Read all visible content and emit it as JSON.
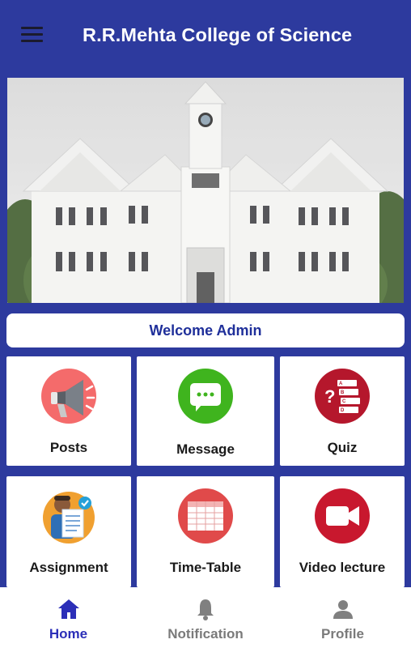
{
  "app_bar": {
    "title": "R.R.Mehta College of Science",
    "menu_icon": "hamburger-menu-icon"
  },
  "banner": {
    "image": "college-building-photo"
  },
  "welcome": {
    "text": "Welcome Admin"
  },
  "tiles": [
    {
      "label": "Posts",
      "icon": "megaphone-icon",
      "color": "#f46b6b"
    },
    {
      "label": "Message",
      "icon": "chat-bubble-icon",
      "color": "#3fb41e"
    },
    {
      "label": "Quiz",
      "icon": "quiz-checklist-icon",
      "color": "#b5172c"
    },
    {
      "label": "Assignment",
      "icon": "student-assignment-icon",
      "color": "#f0a030"
    },
    {
      "label": "Time-Table",
      "icon": "timetable-grid-icon",
      "color": "#e04a4a"
    },
    {
      "label": "Video lecture",
      "icon": "video-camera-icon",
      "color": "#c8182e"
    }
  ],
  "bottom_nav": {
    "items": [
      {
        "label": "Home",
        "icon": "home-icon",
        "active": true
      },
      {
        "label": "Notification",
        "icon": "bell-icon",
        "active": false
      },
      {
        "label": "Profile",
        "icon": "person-icon",
        "active": false
      }
    ],
    "active_color": "#2c2fb8",
    "inactive_color": "#7a7a7a"
  },
  "colors": {
    "primary": "#2d3a9e",
    "welcome_text": "#1f2f9a"
  }
}
